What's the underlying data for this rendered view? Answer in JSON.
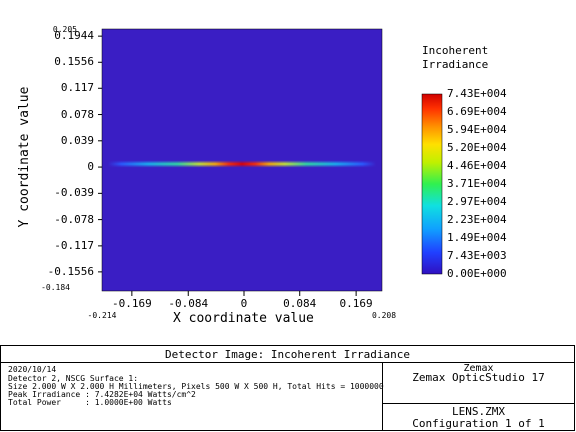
{
  "chart_data": {
    "type": "heatmap",
    "xlabel": "X coordinate value",
    "ylabel": "Y coordinate value",
    "xlim": [
      -0.214,
      0.208
    ],
    "ylim": [
      -0.184,
      0.205
    ],
    "xlim_labels": [
      "-0.214",
      "0.208"
    ],
    "ylim_labels": [
      "-0.184",
      "0.205"
    ],
    "x_ticks": [
      "-0.169",
      "-0.084",
      "0",
      "0.084",
      "0.169"
    ],
    "y_ticks": [
      "0.1944",
      "0.1556",
      "0.117",
      "0.078",
      "0.039",
      "0",
      "-0.039",
      "-0.078",
      "-0.117",
      "-0.1556"
    ],
    "colorbar": {
      "title_line1": "Incoherent",
      "title_line2": "Irradiance",
      "labels": [
        "7.43E+004",
        "6.69E+004",
        "5.94E+004",
        "5.20E+004",
        "4.46E+004",
        "3.71E+004",
        "2.97E+004",
        "2.23E+004",
        "1.49E+004",
        "7.43E+003",
        "0.00E+000"
      ],
      "min": 0,
      "max": 74300
    },
    "background_color": "#3a1ec4",
    "feature": "horizontal line source at y = 0 spanning x ≈ -0.184 to 0.184, peak irradiance at center"
  },
  "footer": {
    "title": "Detector Image: Incoherent Irradiance",
    "date": "2020/10/14",
    "line2": "Detector 2, NSCG Surface 1:",
    "line3": "Size 2.000 W X 2.000 H Millimeters, Pixels 500 W X 500 H, Total Hits = 1000000",
    "line4": "Peak Irradiance : 7.4282E+04 Watts/cm^2",
    "line5": "Total Power     : 1.0000E+00 Watts",
    "company": "Zemax",
    "product": "Zemax OpticStudio 17",
    "file": "LENS.ZMX",
    "config": "Configuration 1 of 1"
  }
}
